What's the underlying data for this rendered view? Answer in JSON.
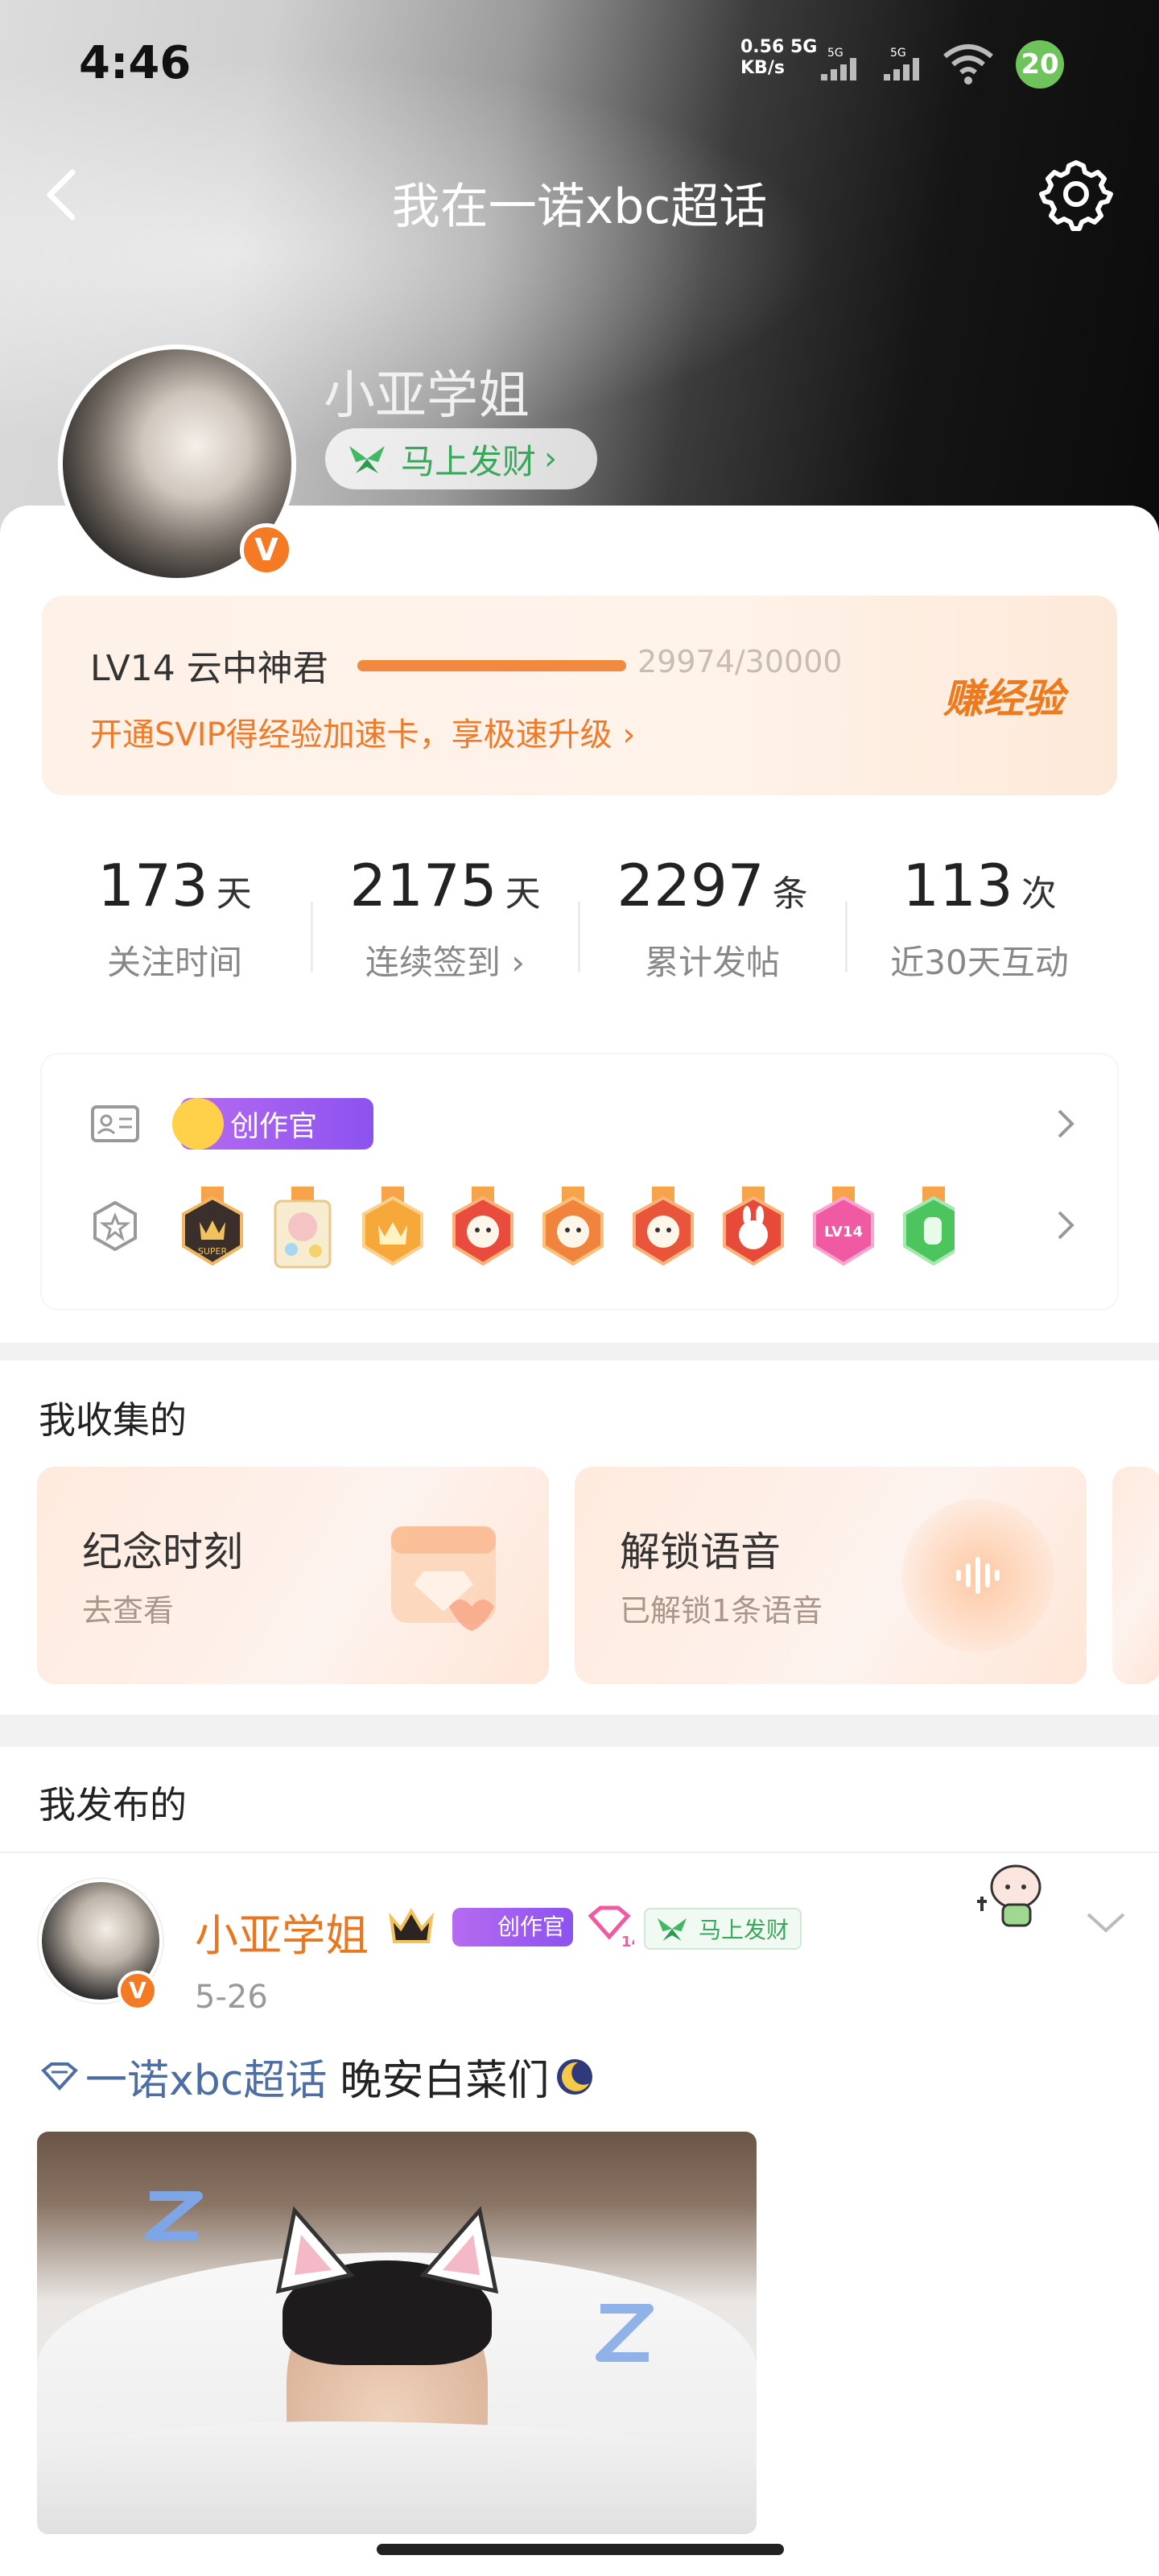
{
  "status_bar": {
    "time": "4:46",
    "net_speed": "0.56",
    "net_unit": "KB/s",
    "net_type1": "5G",
    "net_type2": "5G",
    "battery": "20"
  },
  "header": {
    "title": "我在一诺xbc超话"
  },
  "profile": {
    "name": "小亚学姐",
    "verified_mark": "V",
    "fortune_label": "马上发财",
    "fortune_chevron": "›"
  },
  "level": {
    "level_text": "LV14 云中神君",
    "progress_text": "29974/30000",
    "progress_fraction": 0.9991,
    "svip_text": "开通SVIP得经验加速卡，享极速升级",
    "svip_chevron": "›",
    "earn_label": "赚经验"
  },
  "stats": [
    {
      "value": "173",
      "unit": "天",
      "label": "关注时间"
    },
    {
      "value": "2175",
      "unit": "天",
      "label": "连续签到 ›"
    },
    {
      "value": "2297",
      "unit": "条",
      "label": "累计发帖"
    },
    {
      "value": "113",
      "unit": "次",
      "label": "近30天互动"
    }
  ],
  "badges": {
    "creator_label": "创作官",
    "medal_names": [
      "super-medal",
      "card-medal",
      "crown-medal",
      "cat-medal-1",
      "cat-medal-2",
      "cat-medal-3",
      "rabbit-medal",
      "lv14-medal",
      "hand-medal"
    ],
    "lv14_medal_text": "LV14"
  },
  "collections": {
    "section_title": "我收集的",
    "items": [
      {
        "title": "纪念时刻",
        "subtitle": "去查看"
      },
      {
        "title": "解锁语音",
        "subtitle": "已解锁1条语音"
      }
    ]
  },
  "posts": {
    "section_title": "我发布的",
    "author": "小亚学姐",
    "verified_mark": "V",
    "creator_label": "创作官",
    "fortune_label": "马上发财",
    "level_badge": "14",
    "date": "5-26",
    "topic": "一诺xbc超话",
    "content": "晚安白菜们"
  },
  "colors": {
    "accent_orange": "#f18a3f",
    "fortune_green": "#3aa85a",
    "topic_blue": "#4d6ea3",
    "creator_purple": "#9a5cf0"
  }
}
